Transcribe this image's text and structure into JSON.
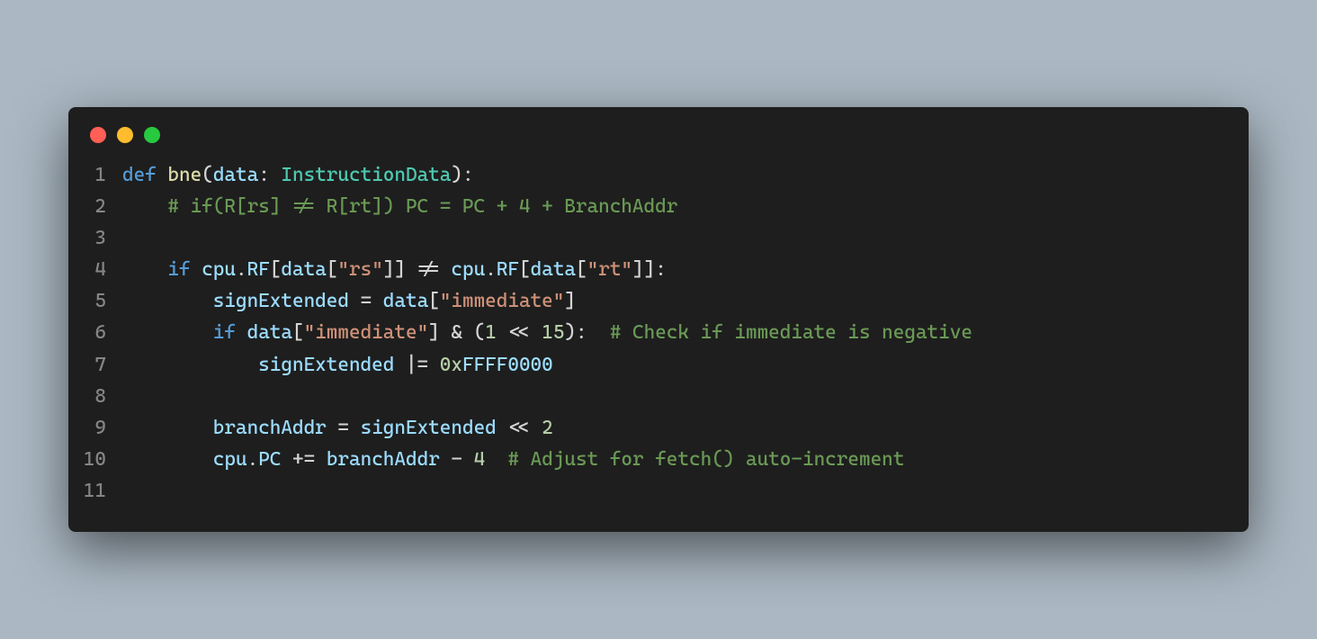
{
  "window": {
    "dots": [
      "red",
      "yellow",
      "green"
    ]
  },
  "code": {
    "lines": [
      {
        "n": "1",
        "tokens": [
          {
            "cls": "kw",
            "t": "def"
          },
          {
            "cls": "pun",
            "t": " "
          },
          {
            "cls": "fn",
            "t": "bne"
          },
          {
            "cls": "pun",
            "t": "("
          },
          {
            "cls": "var",
            "t": "data"
          },
          {
            "cls": "pun",
            "t": ": "
          },
          {
            "cls": "cls",
            "t": "InstructionData"
          },
          {
            "cls": "pun",
            "t": "):"
          }
        ]
      },
      {
        "n": "2",
        "tokens": [
          {
            "cls": "pun",
            "t": "    "
          },
          {
            "cls": "cmt",
            "t": "# if(R[rs] != R[rt]) PC = PC + 4 + BranchAddr"
          }
        ]
      },
      {
        "n": "3",
        "tokens": []
      },
      {
        "n": "4",
        "tokens": [
          {
            "cls": "pun",
            "t": "    "
          },
          {
            "cls": "kw",
            "t": "if"
          },
          {
            "cls": "pun",
            "t": " "
          },
          {
            "cls": "var",
            "t": "cpu"
          },
          {
            "cls": "pun",
            "t": "."
          },
          {
            "cls": "var",
            "t": "RF"
          },
          {
            "cls": "pun",
            "t": "["
          },
          {
            "cls": "var",
            "t": "data"
          },
          {
            "cls": "pun",
            "t": "["
          },
          {
            "cls": "str",
            "t": "\"rs\""
          },
          {
            "cls": "pun",
            "t": "]] "
          },
          {
            "cls": "op",
            "t": "!="
          },
          {
            "cls": "pun",
            "t": " "
          },
          {
            "cls": "var",
            "t": "cpu"
          },
          {
            "cls": "pun",
            "t": "."
          },
          {
            "cls": "var",
            "t": "RF"
          },
          {
            "cls": "pun",
            "t": "["
          },
          {
            "cls": "var",
            "t": "data"
          },
          {
            "cls": "pun",
            "t": "["
          },
          {
            "cls": "str",
            "t": "\"rt\""
          },
          {
            "cls": "pun",
            "t": "]]:"
          }
        ]
      },
      {
        "n": "5",
        "tokens": [
          {
            "cls": "pun",
            "t": "        "
          },
          {
            "cls": "var",
            "t": "signExtended"
          },
          {
            "cls": "pun",
            "t": " "
          },
          {
            "cls": "op",
            "t": "="
          },
          {
            "cls": "pun",
            "t": " "
          },
          {
            "cls": "var",
            "t": "data"
          },
          {
            "cls": "pun",
            "t": "["
          },
          {
            "cls": "str",
            "t": "\"immediate\""
          },
          {
            "cls": "pun",
            "t": "]"
          }
        ]
      },
      {
        "n": "6",
        "tokens": [
          {
            "cls": "pun",
            "t": "        "
          },
          {
            "cls": "kw",
            "t": "if"
          },
          {
            "cls": "pun",
            "t": " "
          },
          {
            "cls": "var",
            "t": "data"
          },
          {
            "cls": "pun",
            "t": "["
          },
          {
            "cls": "str",
            "t": "\"immediate\""
          },
          {
            "cls": "pun",
            "t": "] "
          },
          {
            "cls": "op",
            "t": "&"
          },
          {
            "cls": "pun",
            "t": " ("
          },
          {
            "cls": "num",
            "t": "1"
          },
          {
            "cls": "pun",
            "t": " "
          },
          {
            "cls": "op",
            "t": "<<"
          },
          {
            "cls": "pun",
            "t": " "
          },
          {
            "cls": "num",
            "t": "15"
          },
          {
            "cls": "pun",
            "t": "):  "
          },
          {
            "cls": "cmt",
            "t": "# Check if immediate is negative"
          }
        ]
      },
      {
        "n": "7",
        "tokens": [
          {
            "cls": "pun",
            "t": "            "
          },
          {
            "cls": "var",
            "t": "signExtended"
          },
          {
            "cls": "pun",
            "t": " "
          },
          {
            "cls": "op",
            "t": "|="
          },
          {
            "cls": "pun",
            "t": " "
          },
          {
            "cls": "num",
            "t": "0x"
          },
          {
            "cls": "var",
            "t": "FFFF0000"
          }
        ]
      },
      {
        "n": "8",
        "tokens": []
      },
      {
        "n": "9",
        "tokens": [
          {
            "cls": "pun",
            "t": "        "
          },
          {
            "cls": "var",
            "t": "branchAddr"
          },
          {
            "cls": "pun",
            "t": " "
          },
          {
            "cls": "op",
            "t": "="
          },
          {
            "cls": "pun",
            "t": " "
          },
          {
            "cls": "var",
            "t": "signExtended"
          },
          {
            "cls": "pun",
            "t": " "
          },
          {
            "cls": "op",
            "t": "<<"
          },
          {
            "cls": "pun",
            "t": " "
          },
          {
            "cls": "num",
            "t": "2"
          }
        ]
      },
      {
        "n": "10",
        "tokens": [
          {
            "cls": "pun",
            "t": "        "
          },
          {
            "cls": "var",
            "t": "cpu"
          },
          {
            "cls": "pun",
            "t": "."
          },
          {
            "cls": "var",
            "t": "PC"
          },
          {
            "cls": "pun",
            "t": " "
          },
          {
            "cls": "op",
            "t": "+="
          },
          {
            "cls": "pun",
            "t": " "
          },
          {
            "cls": "var",
            "t": "branchAddr"
          },
          {
            "cls": "pun",
            "t": " "
          },
          {
            "cls": "op",
            "t": "-"
          },
          {
            "cls": "pun",
            "t": " "
          },
          {
            "cls": "num",
            "t": "4"
          },
          {
            "cls": "pun",
            "t": "  "
          },
          {
            "cls": "cmt",
            "t": "# Adjust for fetch() auto-increment"
          }
        ]
      },
      {
        "n": "11",
        "tokens": []
      }
    ]
  }
}
